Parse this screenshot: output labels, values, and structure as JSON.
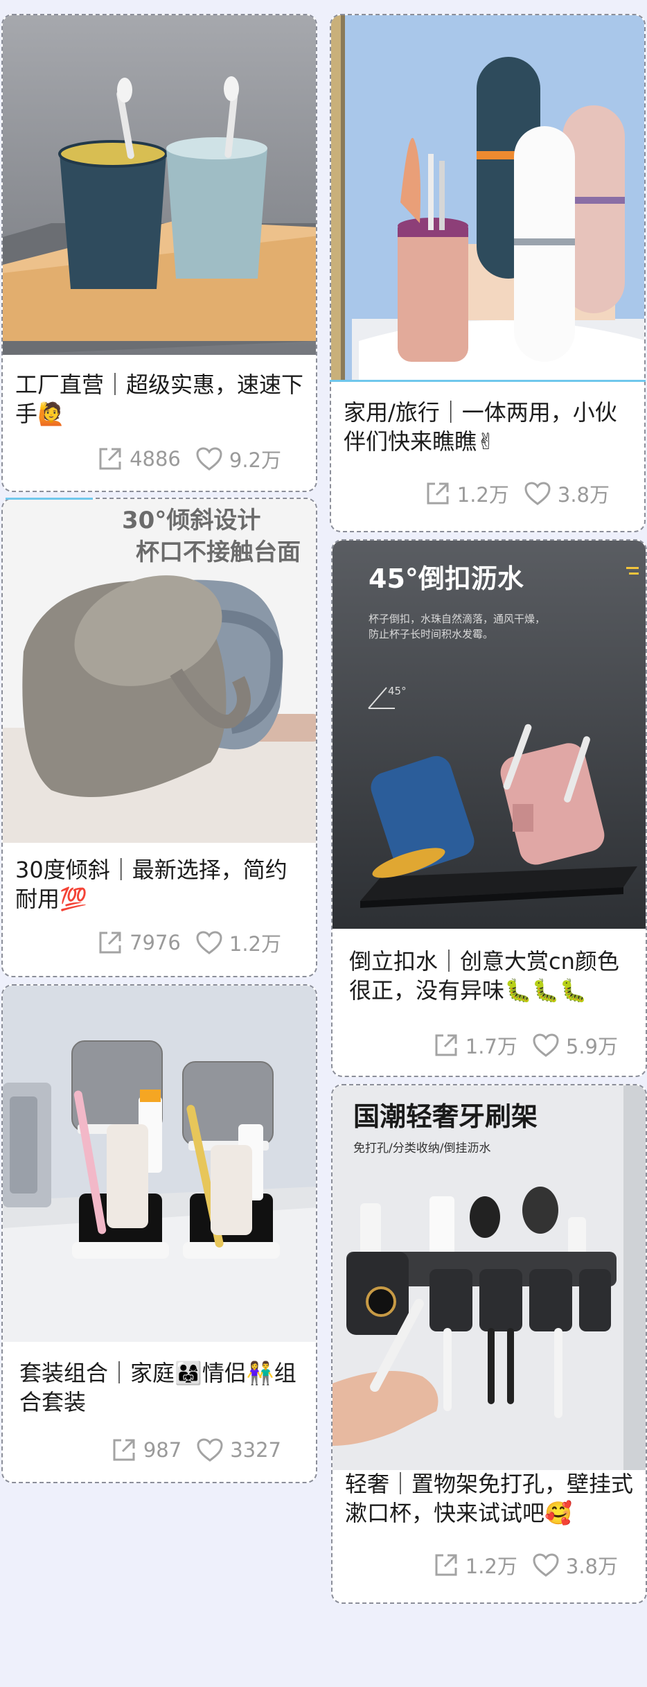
{
  "cards": [
    {
      "caption": "工厂直营｜超级实惠，速速下手🙋",
      "share_count": "4886",
      "like_count": "9.2万"
    },
    {
      "caption": "家用/旅行｜一体两用，小伙伴们快来瞧瞧✌",
      "share_count": "1.2万",
      "like_count": "3.8万"
    },
    {
      "caption": "30度倾斜｜最新选择，简约耐用💯",
      "share_count": "7976",
      "like_count": "1.2万",
      "image_text": {
        "line1": "30°倾斜设计",
        "line2": "杯口不接触台面"
      }
    },
    {
      "caption": "倒立扣水｜创意大赏cn颜色很正，没有异味🐛🐛🐛",
      "share_count": "1.7万",
      "like_count": "5.9万",
      "image_text": {
        "headline": "45°倒扣沥水",
        "sub1": "杯子倒扣，水珠自然滴落，通风干燥，",
        "sub2": "防止杯子长时间积水发霉。",
        "angle": "45°"
      }
    },
    {
      "caption": "套装组合｜家庭👨‍👩‍👧情侣👫组合套装",
      "share_count": "987",
      "like_count": "3327"
    },
    {
      "caption": "轻奢｜置物架免打孔，壁挂式漱口杯，快来试试吧🥰",
      "share_count": "1.2万",
      "like_count": "3.8万",
      "image_text": {
        "headline": "国潮轻奢牙刷架",
        "sub": "免打孔/分类收纳/倒挂沥水"
      }
    }
  ],
  "icons": {
    "share": "share-icon",
    "like": "heart-icon"
  },
  "colors": {
    "background": "#eef0fb",
    "accent_line": "#6fc7ec",
    "stat_text": "#9a9a9a"
  }
}
